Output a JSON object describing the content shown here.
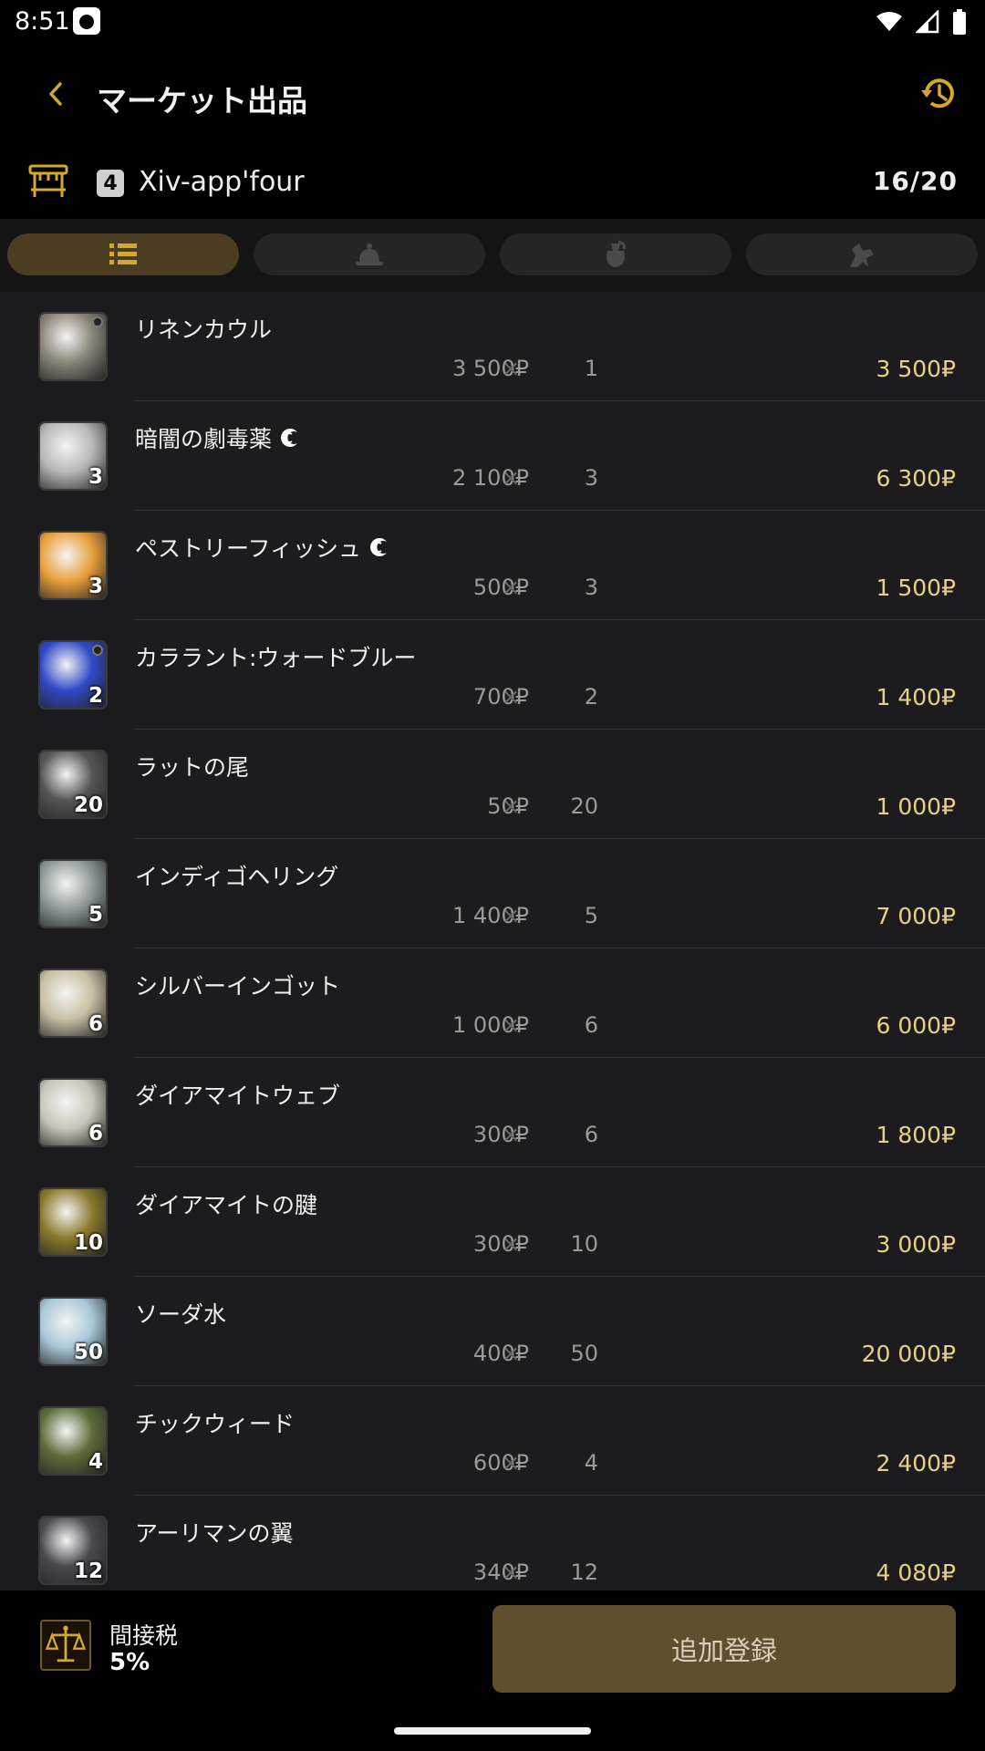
{
  "status_bar": {
    "time": "8:51"
  },
  "header": {
    "title": "マーケット出品"
  },
  "retainer": {
    "number": "4",
    "name": "Xiv-app'four",
    "count": "16/20"
  },
  "tabs": [
    {
      "icon": "list-icon",
      "active": true
    },
    {
      "icon": "bell-icon",
      "active": false
    },
    {
      "icon": "pot-icon",
      "active": false
    },
    {
      "icon": "chocobo-icon",
      "active": false
    }
  ],
  "items": [
    {
      "name": "リネンカウル",
      "hq": false,
      "qty_badge": "",
      "unit_price": "3 500₽",
      "times": "×",
      "quantity": "1",
      "total": "3 500₽",
      "icon_color": "#8a8578"
    },
    {
      "name": "暗闇の劇毒薬",
      "hq": true,
      "qty_badge": "3",
      "unit_price": "2 100₽",
      "times": "×",
      "quantity": "3",
      "total": "6 300₽",
      "icon_color": "#b8b8b8"
    },
    {
      "name": "ペストリーフィッシュ",
      "hq": true,
      "qty_badge": "3",
      "unit_price": "500₽",
      "times": "×",
      "quantity": "3",
      "total": "1 500₽",
      "icon_color": "#e9a03c"
    },
    {
      "name": "カララント:ウォードブルー",
      "hq": false,
      "qty_badge": "2",
      "unit_price": "700₽",
      "times": "×",
      "quantity": "2",
      "total": "1 400₽",
      "icon_color": "#2f49c7"
    },
    {
      "name": "ラットの尾",
      "hq": false,
      "qty_badge": "20",
      "unit_price": "50₽",
      "times": "×",
      "quantity": "20",
      "total": "1 000₽",
      "icon_color": "#555555"
    },
    {
      "name": "インディゴヘリング",
      "hq": false,
      "qty_badge": "5",
      "unit_price": "1 400₽",
      "times": "×",
      "quantity": "5",
      "total": "7 000₽",
      "icon_color": "#8f9a98"
    },
    {
      "name": "シルバーインゴット",
      "hq": false,
      "qty_badge": "6",
      "unit_price": "1 000₽",
      "times": "×",
      "quantity": "6",
      "total": "6 000₽",
      "icon_color": "#c9bfa4"
    },
    {
      "name": "ダイアマイトウェブ",
      "hq": false,
      "qty_badge": "6",
      "unit_price": "300₽",
      "times": "×",
      "quantity": "6",
      "total": "1 800₽",
      "icon_color": "#c8c6b8"
    },
    {
      "name": "ダイアマイトの腱",
      "hq": false,
      "qty_badge": "10",
      "unit_price": "300₽",
      "times": "×",
      "quantity": "10",
      "total": "3 000₽",
      "icon_color": "#8b7a2c"
    },
    {
      "name": "ソーダ水",
      "hq": false,
      "qty_badge": "50",
      "unit_price": "400₽",
      "times": "×",
      "quantity": "50",
      "total": "20 000₽",
      "icon_color": "#a9c8d8"
    },
    {
      "name": "チックウィード",
      "hq": false,
      "qty_badge": "4",
      "unit_price": "600₽",
      "times": "×",
      "quantity": "4",
      "total": "2 400₽",
      "icon_color": "#5d6b3a"
    },
    {
      "name": "アーリマンの翼",
      "hq": false,
      "qty_badge": "12",
      "unit_price": "340₽",
      "times": "×",
      "quantity": "12",
      "total": "4 080₽",
      "icon_color": "#4a4850"
    }
  ],
  "footer": {
    "tax_label": "間接税",
    "tax_value": "5%",
    "add_button": "追加登録"
  },
  "colors": {
    "accent": "#d4a82a",
    "total_text": "#e8cf8a",
    "button_bg": "#5e4f2d"
  }
}
